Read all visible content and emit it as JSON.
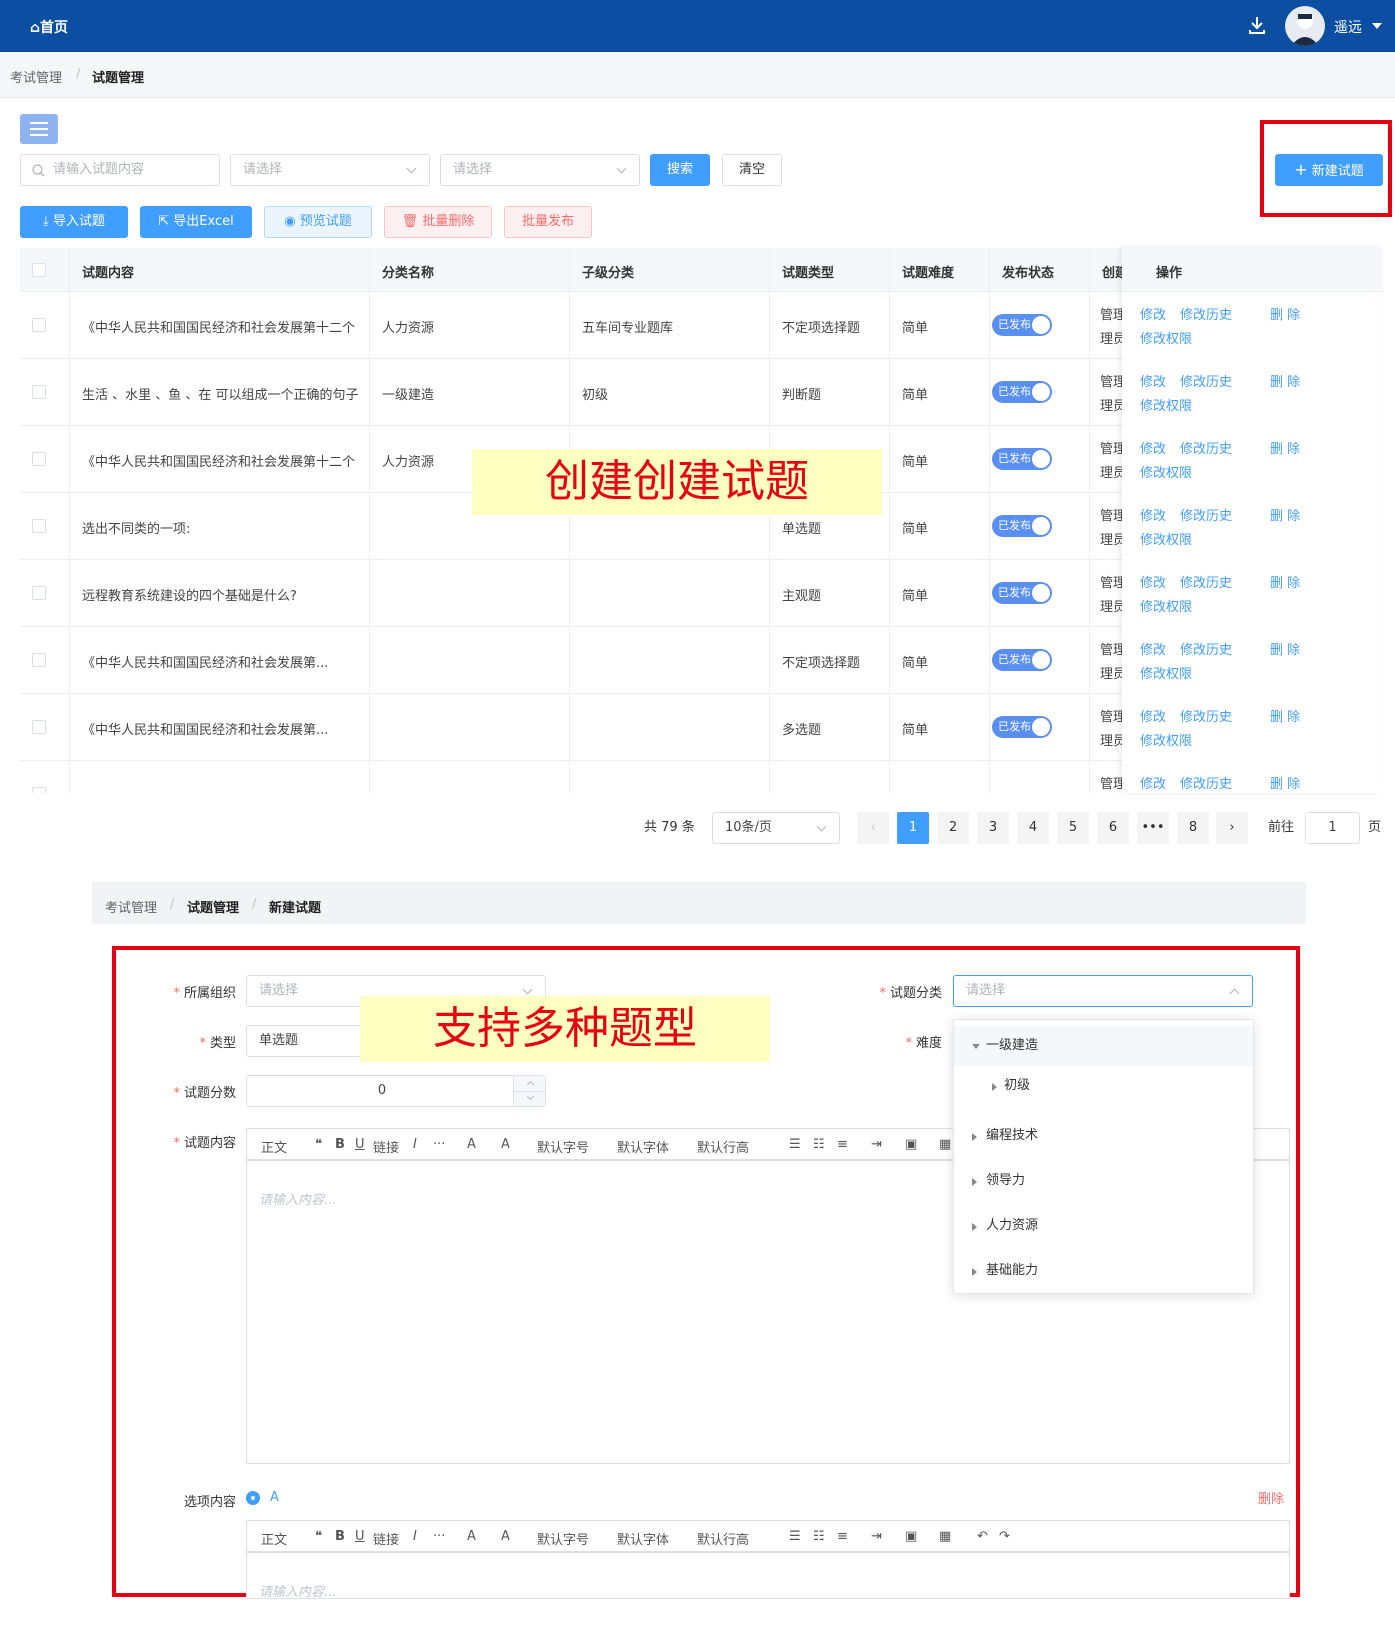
{
  "topbar": {
    "home_label": "首页",
    "username": "遥远"
  },
  "breadcrumb": {
    "items": [
      "考试管理",
      "试题管理"
    ],
    "sep": "/"
  },
  "filters": {
    "search_placeholder": "请输入试题内容",
    "select1_placeholder": "请选择",
    "select2_placeholder": "请选择",
    "search_btn": "搜索",
    "clear_btn": "清空",
    "new_btn": "新建试题"
  },
  "actions": {
    "import": "导入试题",
    "export": "导出Excel",
    "preview": "预览试题",
    "batch_delete": "批量删除",
    "batch_publish": "批量发布"
  },
  "table": {
    "headers": [
      "试题内容",
      "分类名称",
      "子级分类",
      "试题类型",
      "试题难度",
      "发布状态",
      "创建人",
      "操作"
    ],
    "rows": [
      {
        "content": "《中华人民共和国国民经济和社会发展第十二个",
        "category": "人力资源",
        "sub": "五车间专业题库",
        "type": "不定项选择题",
        "difficulty": "简单",
        "status": "已发布",
        "creator1": "管理员",
        "creator2": "理员)"
      },
      {
        "content": "生活 、水里 、鱼 、在 可以组成一个正确的句子",
        "category": "一级建造",
        "sub": "初级",
        "type": "判断题",
        "difficulty": "简单",
        "status": "已发布",
        "creator1": "管理员",
        "creator2": "理员)"
      },
      {
        "content": "《中华人民共和国国民经济和社会发展第十二个",
        "category": "人力资源",
        "sub": "",
        "type": "",
        "difficulty": "简单",
        "status": "已发布",
        "creator1": "管理员",
        "creator2": "理员)"
      },
      {
        "content": "选出不同类的一项:",
        "category": "",
        "sub": "",
        "type": "单选题",
        "difficulty": "简单",
        "status": "已发布",
        "creator1": "管理员",
        "creator2": "理员)"
      },
      {
        "content": "远程教育系统建设的四个基础是什么?",
        "category": "",
        "sub": "",
        "type": "主观题",
        "difficulty": "简单",
        "status": "已发布",
        "creator1": "管理员",
        "creator2": "理员)"
      },
      {
        "content": "《中华人民共和国国民经济和社会发展第...",
        "category": "",
        "sub": "",
        "type": "不定项选择题",
        "difficulty": "简单",
        "status": "已发布",
        "creator1": "管理员",
        "creator2": "理员)"
      },
      {
        "content": "《中华人民共和国国民经济和社会发展第...",
        "category": "",
        "sub": "",
        "type": "多选题",
        "difficulty": "简单",
        "status": "已发布",
        "creator1": "管理员",
        "creator2": "理员)"
      },
      {
        "content": "",
        "category": "",
        "sub": "",
        "type": "",
        "difficulty": "",
        "status": "",
        "creator1": "管理员",
        "creator2": ""
      }
    ],
    "ops": {
      "edit": "修改",
      "history": "修改历史",
      "delete": "删 除",
      "perm": "修改权限"
    }
  },
  "overlay1": "创建创建试题",
  "overlay2": "支持多种题型",
  "pagination": {
    "total": "共 79 条",
    "page_size": "10条/页",
    "pages": [
      "1",
      "2",
      "3",
      "4",
      "5",
      "6",
      "•••",
      "8"
    ],
    "goto_prefix": "前往",
    "goto_value": "1",
    "goto_suffix": "页"
  },
  "breadcrumb2": {
    "items": [
      "考试管理",
      "试题管理",
      "新建试题"
    ],
    "sep": "/"
  },
  "form": {
    "org_label": "所属组织",
    "org_placeholder": "请选择",
    "category_label": "试题分类",
    "category_placeholder": "请选择",
    "type_label": "类型",
    "type_value": "单选题",
    "difficulty_label": "难度",
    "score_label": "试题分数",
    "score_value": "0",
    "content_label": "试题内容",
    "content_placeholder": "请输入内容...",
    "option_label": "选项内容",
    "option_letter": "A",
    "option_delete": "删除",
    "option_placeholder": "请输入内容..."
  },
  "toolbar": {
    "para": "正文",
    "quote": "❝",
    "bold": "B",
    "underline": "U",
    "link": "链接",
    "italic": "I",
    "more": "···",
    "fontcolor": "A",
    "bgcolor": "A",
    "fontsize": "默认字号",
    "fontfamily": "默认字体",
    "lineheight": "默认行高"
  },
  "tree": {
    "items": [
      "一级建造",
      "初级",
      "编程技术",
      "领导力",
      "人力资源",
      "基础能力"
    ]
  }
}
